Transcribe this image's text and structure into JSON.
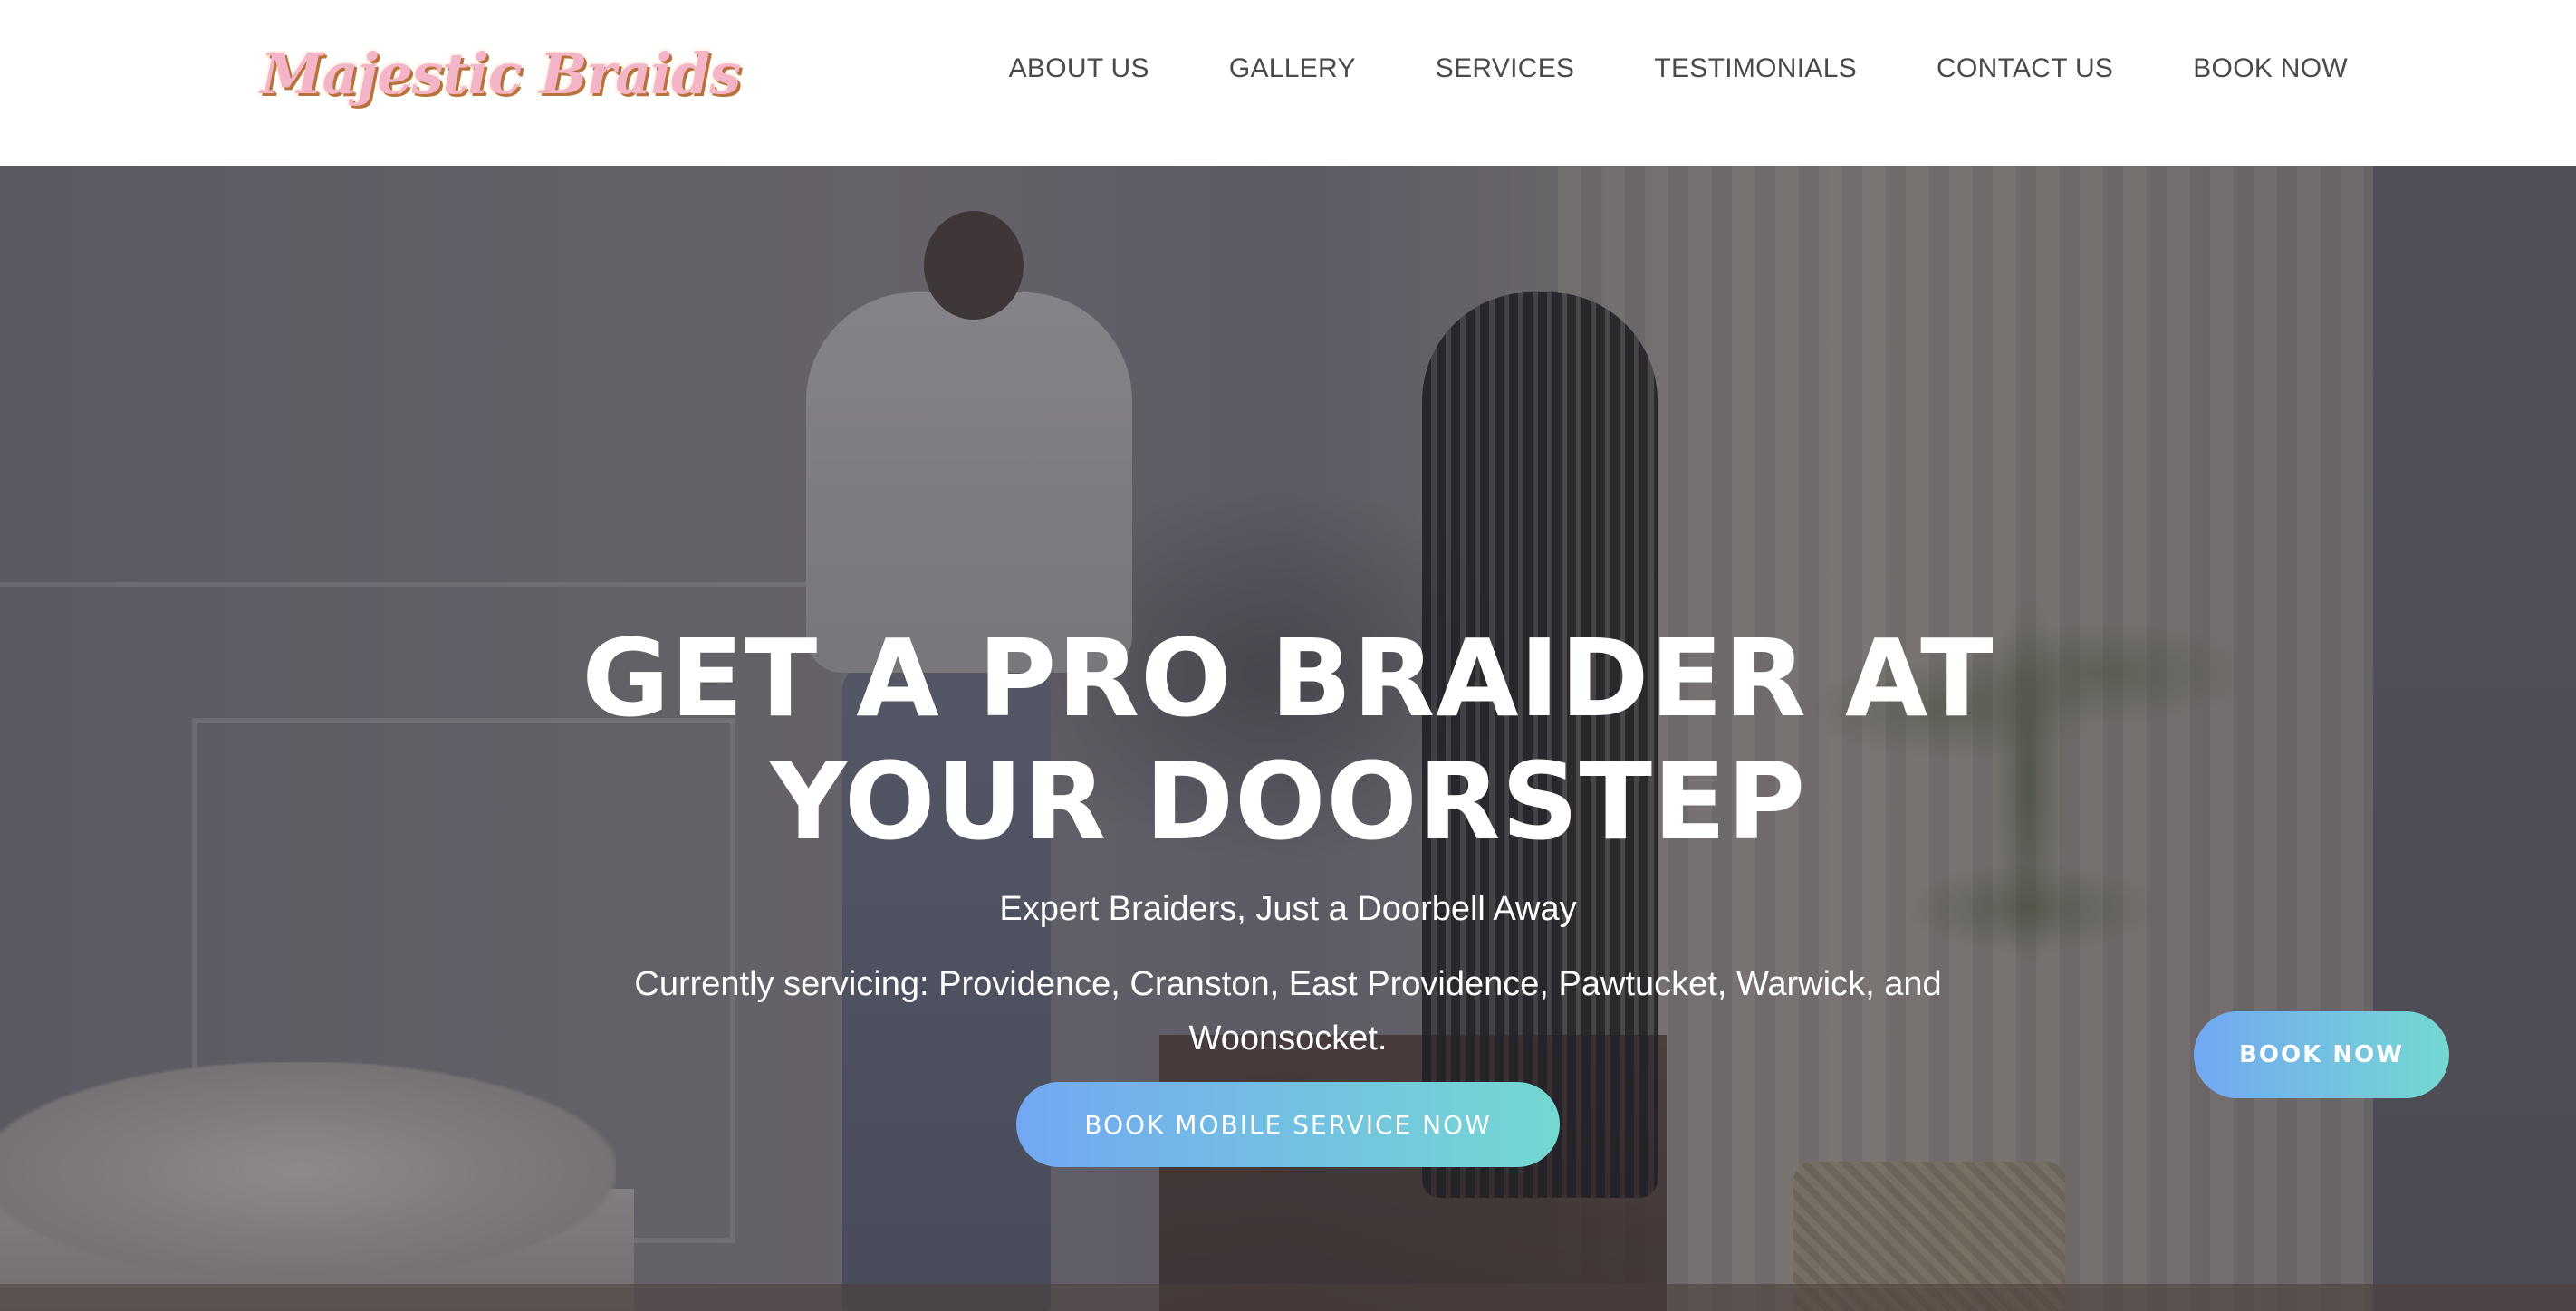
{
  "brand": {
    "logo_text": "Majestic Braids",
    "colors": {
      "logo_fill": "#f4b5c8",
      "logo_outline": "#b9733a",
      "nav_text": "#4a4a4a",
      "button_gradient_start": "#72a8f2",
      "button_gradient_end": "#74d8d2"
    }
  },
  "nav": {
    "items": [
      {
        "label": "ABOUT US"
      },
      {
        "label": "GALLERY"
      },
      {
        "label": "SERVICES"
      },
      {
        "label": "TESTIMONIALS"
      },
      {
        "label": "CONTACT US"
      },
      {
        "label": "BOOK NOW"
      }
    ]
  },
  "hero": {
    "title_line1": "GET A PRO BRAIDER AT",
    "title_line2": "YOUR DOORSTEP",
    "subtitle": "Expert Braiders, Just a Doorbell Away",
    "service_area": "Currently servicing: Providence, Cranston, East Providence, Pawtucket, Warwick, and Woonsocket.",
    "cta_label": "BOOK MOBILE SERVICE NOW"
  },
  "floating_button": {
    "label": "BOOK NOW"
  }
}
